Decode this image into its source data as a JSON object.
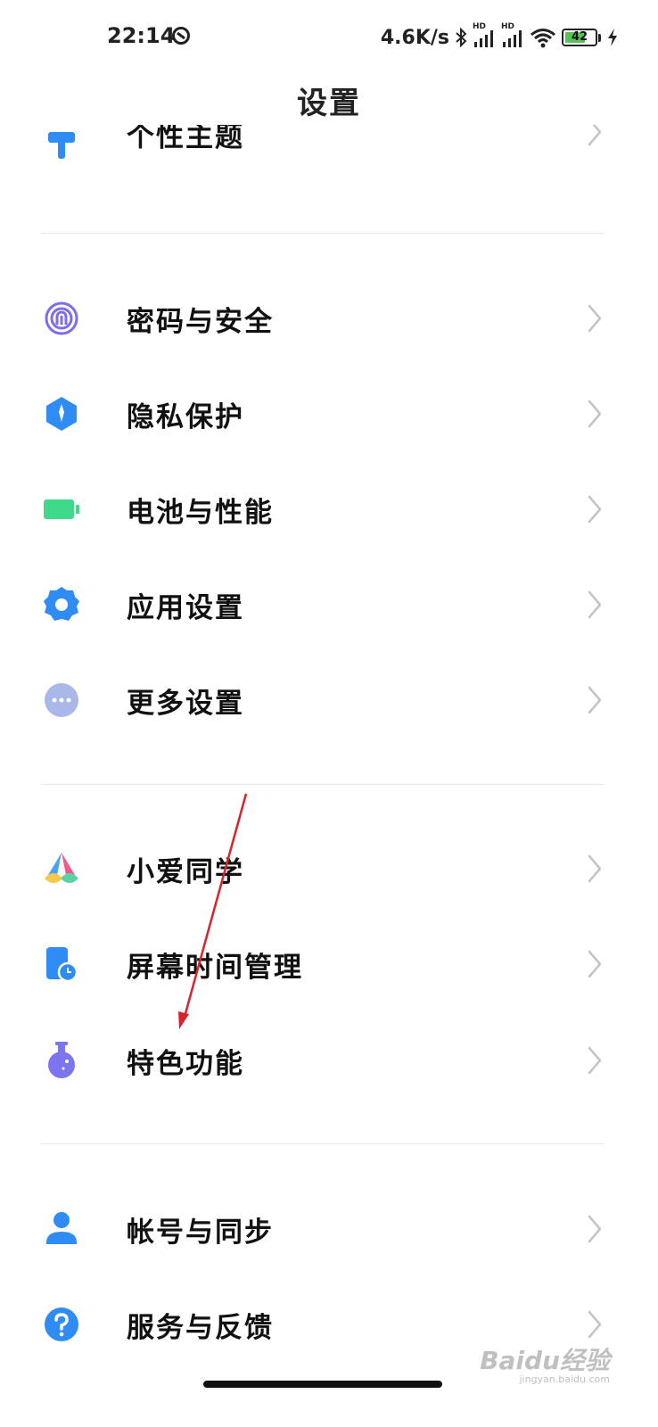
{
  "status_bar": {
    "time": "22:14",
    "net_speed": "4.6K/s",
    "signal_badge_1": "HD",
    "signal_badge_2": "HD",
    "battery_level": "42"
  },
  "header": {
    "title": "设置"
  },
  "partial_item": {
    "label": "个性主题"
  },
  "group_1": [
    {
      "label": "密码与安全",
      "icon": "fingerprint-icon"
    },
    {
      "label": "隐私保护",
      "icon": "privacy-shield-icon"
    },
    {
      "label": "电池与性能",
      "icon": "battery-icon"
    },
    {
      "label": "应用设置",
      "icon": "gear-icon"
    },
    {
      "label": "更多设置",
      "icon": "more-dots-icon"
    }
  ],
  "group_2": [
    {
      "label": "小爱同学",
      "icon": "xiaoai-icon"
    },
    {
      "label": "屏幕时间管理",
      "icon": "screen-time-icon"
    },
    {
      "label": "特色功能",
      "icon": "flask-icon"
    }
  ],
  "group_3": [
    {
      "label": "帐号与同步",
      "icon": "account-icon"
    },
    {
      "label": "服务与反馈",
      "icon": "help-icon"
    }
  ],
  "watermark": {
    "main": "Baidu经验",
    "sub": "jingyan.baidu.com"
  },
  "colors": {
    "accent_blue": "#2f8cf5",
    "fingerprint": "#7b6cf0",
    "battery_green": "#3fd98a",
    "more_gray": "#a9b8e8",
    "flask": "#7d74f0",
    "arrow_red": "#d8232a"
  }
}
